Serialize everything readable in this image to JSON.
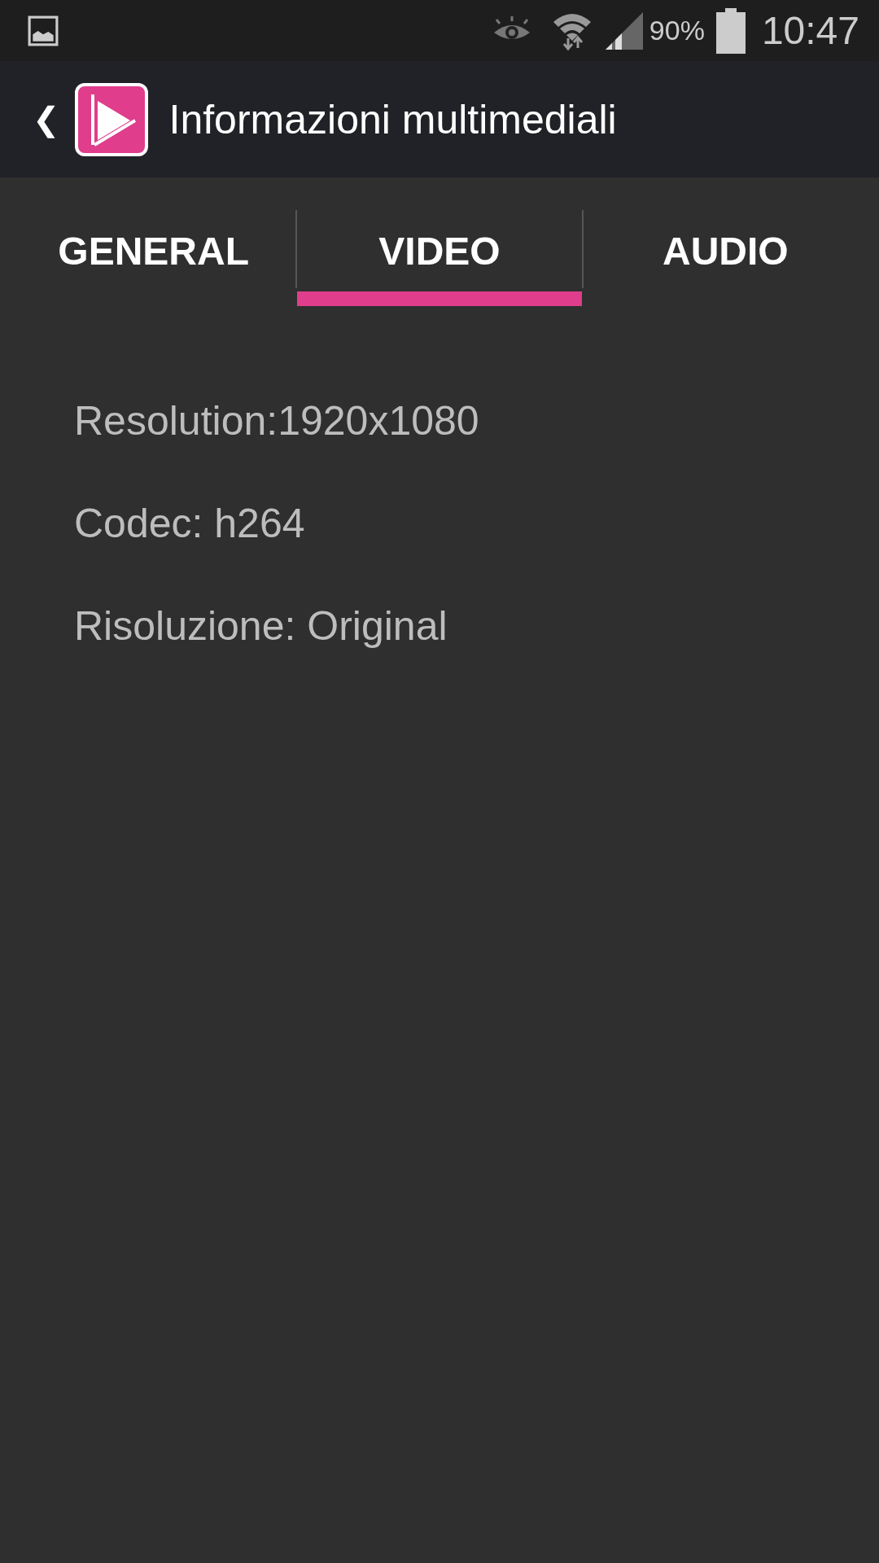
{
  "status_bar": {
    "battery_text": "90%",
    "time": "10:47"
  },
  "app_bar": {
    "back": "❮",
    "title": "Informazioni multimediali"
  },
  "tabs": [
    {
      "label": "GENERAL",
      "selected": false
    },
    {
      "label": "VIDEO",
      "selected": true
    },
    {
      "label": "AUDIO",
      "selected": false
    }
  ],
  "details": [
    "Resolution:1920x1080",
    "Codec: h264",
    "Risoluzione: Original"
  ]
}
